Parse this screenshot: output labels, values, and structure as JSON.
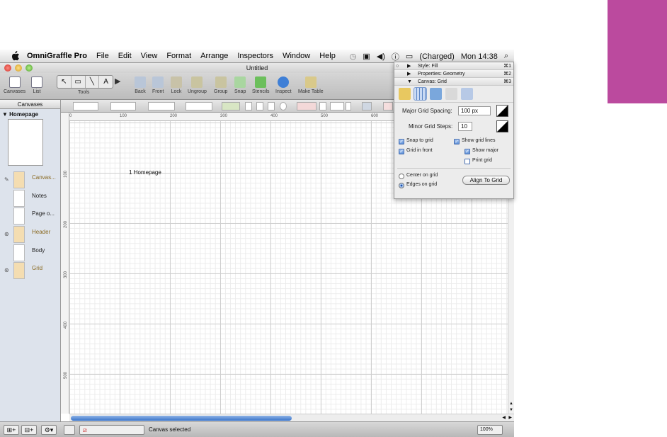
{
  "menubar": {
    "app_name": "OmniGraffle Pro",
    "items": [
      "File",
      "Edit",
      "View",
      "Format",
      "Arrange",
      "Inspectors",
      "Window",
      "Help"
    ],
    "battery": "(Charged)",
    "clock": "Mon 14:38"
  },
  "window": {
    "title": "Untitled"
  },
  "toolbar": {
    "canvases": "Canvases",
    "list": "List",
    "tools": "Tools",
    "back": "Back",
    "front": "Front",
    "lock": "Lock",
    "ungroup": "Ungroup",
    "group": "Group",
    "snap": "Snap",
    "stencils": "Stencils",
    "inspect": "Inspect",
    "make_table": "Make Table"
  },
  "sidebar": {
    "header": "Canvases",
    "canvas_name": "Homepage",
    "layers": [
      {
        "name": "Canvas..."
      },
      {
        "name": "Notes"
      },
      {
        "name": "Page o..."
      },
      {
        "name": "Header"
      },
      {
        "name": "Body"
      },
      {
        "name": "Grid"
      }
    ]
  },
  "canvas": {
    "label": "1 Homepage",
    "ruler_h": [
      "0",
      "100",
      "200",
      "300",
      "400",
      "500",
      "600"
    ],
    "ruler_v": [
      "100",
      "200",
      "300",
      "400",
      "500"
    ]
  },
  "statusbar": {
    "status": "Canvas selected",
    "zoom": "100%"
  },
  "inspector": {
    "rows": [
      {
        "label": "Style: Fill",
        "shortcut": "⌘1"
      },
      {
        "label": "Properties: Geometry",
        "shortcut": "⌘2"
      },
      {
        "label": "Canvas: Grid",
        "shortcut": "⌘3"
      }
    ],
    "major_label": "Major Grid Spacing:",
    "major_value": "100 px",
    "minor_label": "Minor Grid Steps:",
    "minor_value": "10",
    "snap_to_grid": "Snap to grid",
    "show_grid_lines": "Show grid lines",
    "grid_in_front": "Grid in front",
    "show_major": "Show major",
    "print_grid": "Print grid",
    "center_on_grid": "Center on grid",
    "edges_on_grid": "Edges on grid",
    "align_to_grid": "Align To Grid"
  },
  "colors": {
    "accent": "#bb4a9e",
    "selection": "#3a74c9",
    "layer_tan": "#f4ddb1"
  }
}
